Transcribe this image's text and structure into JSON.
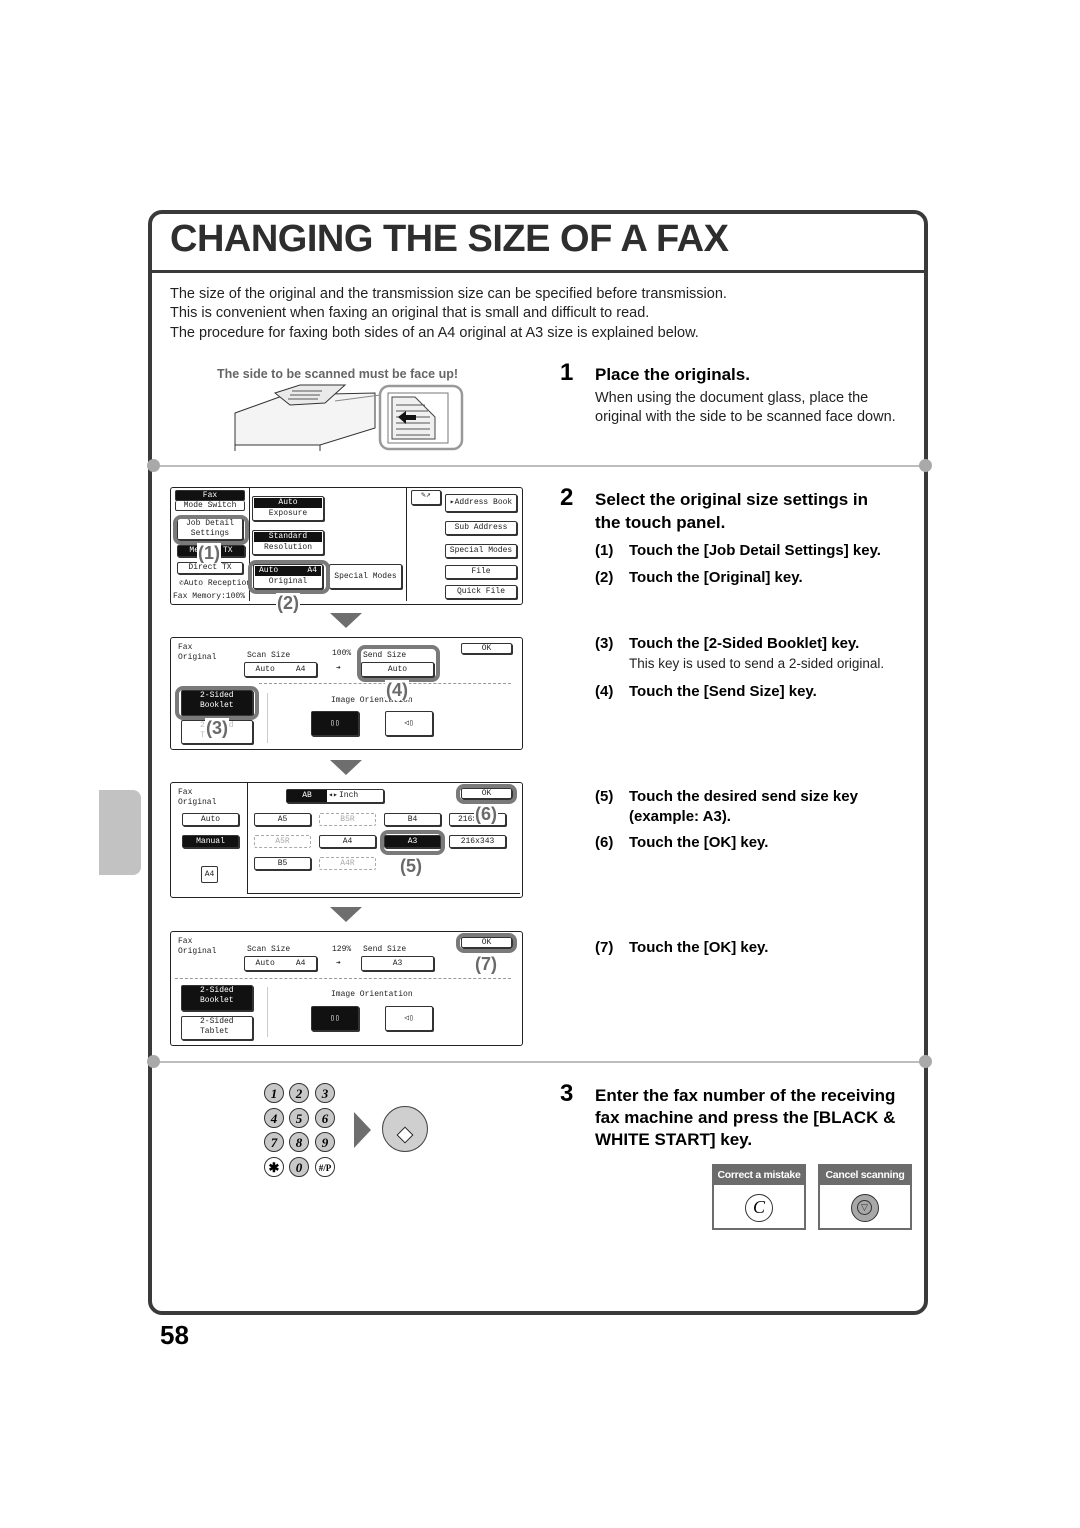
{
  "page": {
    "title": "CHANGING THE SIZE OF A FAX",
    "intro": [
      "The size of the original and the transmission size can be specified before transmission.",
      "This is convenient when faxing an original that is small and difficult to read.",
      "The procedure for faxing both sides of an A4 original at A3 size is explained below."
    ],
    "page_number": "58"
  },
  "colors": {
    "frame": "#3a3a3a",
    "accent_gray": "#6c6c6c",
    "tab": "#c2c2c2",
    "separator": "#bdbdbd"
  },
  "step1": {
    "number": "1",
    "heading": "Place the originals.",
    "body": [
      "When using the document glass, place the",
      "original with the side to be scanned face down."
    ],
    "illustration_caption": "The side to be scanned must be face up!"
  },
  "step2": {
    "number": "2",
    "heading": [
      "Select the original size settings in",
      "the touch panel."
    ],
    "substeps": [
      {
        "n": "(1)",
        "text": "Touch the [Job Detail Settings] key."
      },
      {
        "n": "(2)",
        "text": "Touch the [Original] key."
      },
      {
        "n": "(3)",
        "text": "Touch the [2-Sided Booklet] key.",
        "note": "This key is used to send a 2-sided original."
      },
      {
        "n": "(4)",
        "text": "Touch the [Send Size] key."
      },
      {
        "n": "(5)",
        "text": "Touch the desired send size key",
        "text2": "(example: A3)."
      },
      {
        "n": "(6)",
        "text": "Touch the [OK] key."
      },
      {
        "n": "(7)",
        "text": "Touch the [OK] key."
      }
    ]
  },
  "screen1": {
    "fax": "Fax",
    "mode_switch": "Mode Switch",
    "job_detail": [
      "Job Detail",
      "Settings"
    ],
    "memory_tx": "Memory TX",
    "direct_tx": "Direct TX",
    "auto_reception": "Auto Reception",
    "fax_memory": "Fax Memory:100%",
    "exposure_value": "Auto",
    "exposure_label": "Exposure",
    "resolution_value": "Standard",
    "resolution_label": "Resolution",
    "original_value_left": "Auto",
    "original_value_right": "A4",
    "original_label": "Original",
    "special_modes_center": "Special Modes",
    "right_keys": [
      "Address Book",
      "Sub Address",
      "Special Modes",
      "File",
      "Quick File"
    ],
    "callouts": [
      "(1)",
      "(2)"
    ]
  },
  "screen2": {
    "title": [
      "Fax",
      "Original"
    ],
    "scan_size_label": "Scan Size",
    "scan_size_left": "Auto",
    "scan_size_right": "A4",
    "ratio": "100%",
    "arrow": "➔",
    "send_size_label": "Send Size",
    "send_size_value": "Auto",
    "ok": "OK",
    "booklet": [
      "2-Sided",
      "Booklet"
    ],
    "tablet": [
      "2-Sided",
      "Tablet"
    ],
    "image_orientation": "Image Orientation",
    "callouts": [
      "(3)",
      "(4)"
    ]
  },
  "screen3": {
    "title": [
      "Fax",
      "Original"
    ],
    "unit_ab": "AB",
    "unit_inch": "Inch",
    "ok": "OK",
    "auto": "Auto",
    "manual": "Manual",
    "paper_icon_label": "A4",
    "sizes_row1": [
      "A5",
      "B5R",
      "B4",
      "216x"
    ],
    "sizes_row2": [
      "A5R",
      "A4",
      "A3",
      "216x343"
    ],
    "sizes_row3": [
      "B5",
      "A4R"
    ],
    "callouts": [
      "(5)",
      "(6)"
    ]
  },
  "screen4": {
    "title": [
      "Fax",
      "Original"
    ],
    "scan_size_label": "Scan Size",
    "scan_size_left": "Auto",
    "scan_size_right": "A4",
    "ratio": "129%",
    "arrow": "➔",
    "send_size_label": "Send Size",
    "send_size_value": "A3",
    "ok": "OK",
    "booklet": [
      "2-Sided",
      "Booklet"
    ],
    "tablet": [
      "2-Sided",
      "Tablet"
    ],
    "image_orientation": "Image Orientation",
    "callouts": [
      "(7)"
    ]
  },
  "step3": {
    "number": "3",
    "heading": [
      "Enter the fax number of the receiving",
      "fax machine and press the [BLACK &",
      "WHITE START] key."
    ],
    "keypad": [
      "1",
      "2",
      "3",
      "4",
      "5",
      "6",
      "7",
      "8",
      "9",
      "✱",
      "0",
      "#/P"
    ],
    "start_icon": "start-diamond-icon",
    "hints": [
      {
        "label": "Correct a mistake",
        "glyph": "C"
      },
      {
        "label": "Cancel scanning",
        "glyph": "stop-icon"
      }
    ]
  }
}
